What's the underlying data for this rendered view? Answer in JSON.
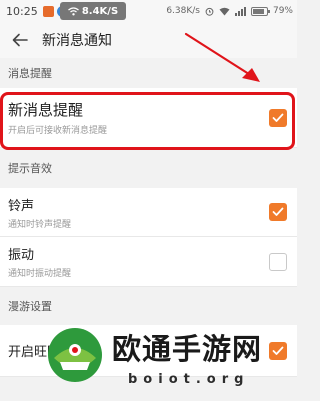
{
  "status_bar": {
    "time": "10:25",
    "network_speed": "8.4K/S",
    "right_speed": "6.38K/s",
    "battery_percent": "79%"
  },
  "header": {
    "title": "新消息通知"
  },
  "sections": {
    "reminder": {
      "header": "消息提醒",
      "rows": [
        {
          "title": "新消息提醒",
          "subtitle": "开启后可接收新消息提醒",
          "checked": true
        }
      ]
    },
    "sound": {
      "header": "提示音效",
      "rows": [
        {
          "title": "铃声",
          "subtitle": "通知时铃声提醒",
          "checked": true
        },
        {
          "title": "振动",
          "subtitle": "通知时振动提醒",
          "checked": false
        }
      ]
    },
    "roaming": {
      "header": "漫游设置",
      "rows": [
        {
          "title": "开启旺旺消息漫",
          "subtitle": "",
          "checked": true
        }
      ]
    }
  },
  "watermark": {
    "name": "欧通手游网",
    "url": "boiot.org"
  },
  "colors": {
    "accent": "#f07a2a",
    "highlight": "#e0141a"
  }
}
